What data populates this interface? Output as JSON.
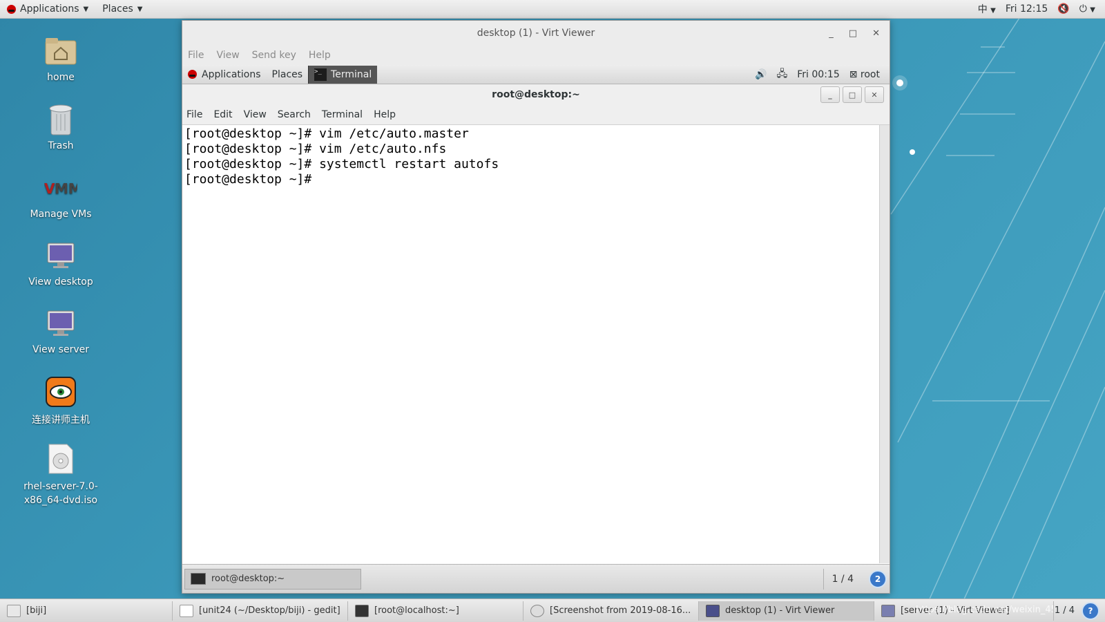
{
  "host_topbar": {
    "applications": "Applications",
    "places": "Places",
    "input_method": "中",
    "clock": "Fri 12:15"
  },
  "desktop_icons": [
    {
      "label": "home",
      "icon": "home-folder-icon"
    },
    {
      "label": "Trash",
      "icon": "trash-icon"
    },
    {
      "label": "Manage VMs",
      "icon": "vm-manager-icon"
    },
    {
      "label": "View desktop",
      "icon": "monitor-icon"
    },
    {
      "label": "View server",
      "icon": "monitor-icon"
    },
    {
      "label": "连接讲师主机",
      "icon": "remote-connect-icon"
    },
    {
      "label": "rhel-server-7.0-x86_64-dvd.iso",
      "icon": "disc-image-icon"
    }
  ],
  "virt_viewer": {
    "title": "desktop (1) - Virt Viewer",
    "menu": [
      "File",
      "View",
      "Send key",
      "Help"
    ]
  },
  "guest_topbar": {
    "applications": "Applications",
    "places": "Places",
    "terminal": "Terminal",
    "clock": "Fri 00:15",
    "user": "root"
  },
  "terminal": {
    "title": "root@desktop:~",
    "menu": [
      "File",
      "Edit",
      "View",
      "Search",
      "Terminal",
      "Help"
    ],
    "lines": [
      "[root@desktop ~]# vim /etc/auto.master",
      "[root@desktop ~]# vim /etc/auto.nfs",
      "[root@desktop ~]# systemctl restart autofs",
      "[root@desktop ~]# "
    ]
  },
  "guest_bottombar": {
    "task": "root@desktop:~",
    "workspace": "1 / 4"
  },
  "host_bottombar": {
    "tasks": [
      {
        "label": "[biji]"
      },
      {
        "label": "[unit24 (~/Desktop/biji) - gedit]"
      },
      {
        "label": "[root@localhost:~]"
      },
      {
        "label": "[Screenshot from 2019-08-16..."
      },
      {
        "label": "desktop (1) - Virt Viewer"
      },
      {
        "label": "[server (1) - Virt Viewer]"
      }
    ],
    "workspace": "1 / 4",
    "watermark": "https://blog.csdn.net/weixin_45428542"
  },
  "colors": {
    "accent": "#3a78c9",
    "redhat": "#cc0000",
    "wallpaper": "#3a97b8"
  }
}
